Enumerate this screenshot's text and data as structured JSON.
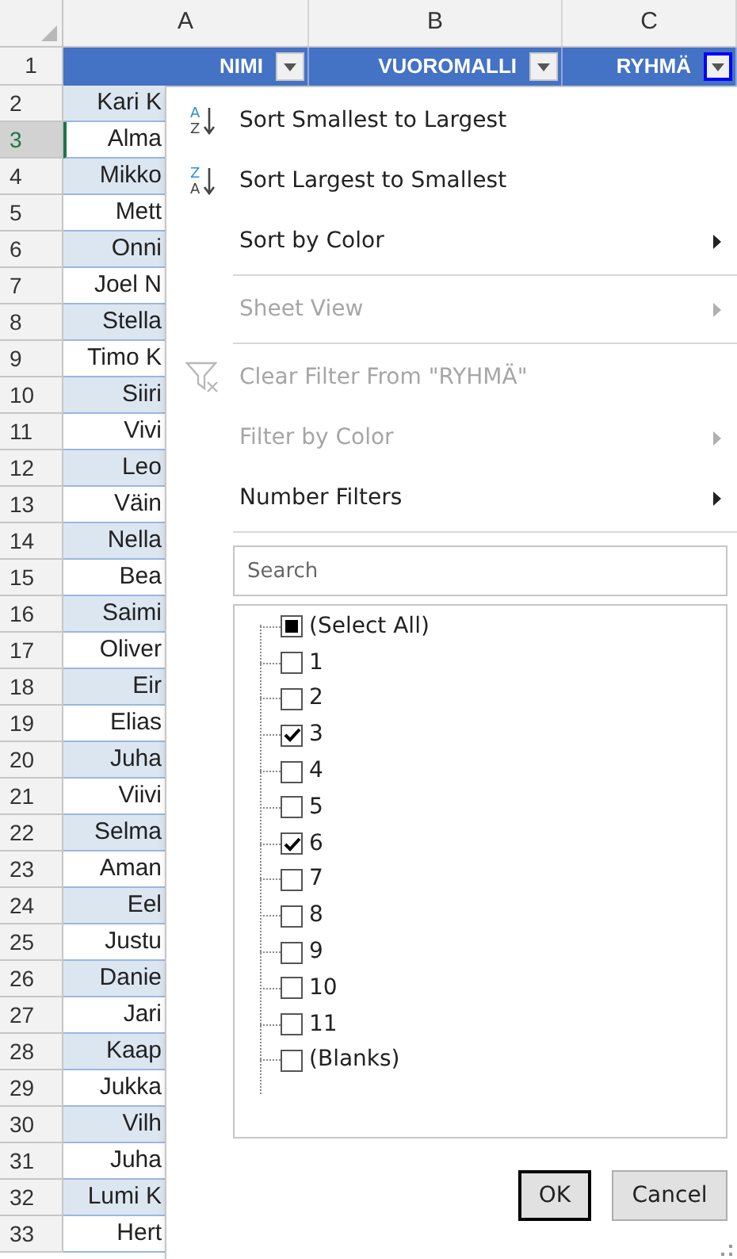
{
  "column_headers": [
    {
      "label": "A"
    },
    {
      "label": "B"
    },
    {
      "label": "C"
    }
  ],
  "header_row": {
    "number": "1",
    "cells": [
      {
        "text": "NIMI",
        "focused": false
      },
      {
        "text": "VUOROMALLI",
        "focused": false
      },
      {
        "text": "RYHMÄ",
        "focused": true
      }
    ]
  },
  "rows": [
    {
      "number": "2",
      "name": "Kari K",
      "selected": false
    },
    {
      "number": "3",
      "name": "Alma",
      "selected": true
    },
    {
      "number": "4",
      "name": "Mikko",
      "selected": false
    },
    {
      "number": "5",
      "name": "Mett",
      "selected": false
    },
    {
      "number": "6",
      "name": "Onni",
      "selected": false
    },
    {
      "number": "7",
      "name": "Joel N",
      "selected": false
    },
    {
      "number": "8",
      "name": "Stella",
      "selected": false
    },
    {
      "number": "9",
      "name": "Timo K",
      "selected": false
    },
    {
      "number": "10",
      "name": "Siiri",
      "selected": false
    },
    {
      "number": "11",
      "name": "Vivi",
      "selected": false
    },
    {
      "number": "12",
      "name": "Leo",
      "selected": false
    },
    {
      "number": "13",
      "name": "Väin",
      "selected": false
    },
    {
      "number": "14",
      "name": "Nella",
      "selected": false
    },
    {
      "number": "15",
      "name": "Bea",
      "selected": false
    },
    {
      "number": "16",
      "name": "Saimi",
      "selected": false
    },
    {
      "number": "17",
      "name": "Oliver",
      "selected": false
    },
    {
      "number": "18",
      "name": "Eir",
      "selected": false
    },
    {
      "number": "19",
      "name": "Elias",
      "selected": false
    },
    {
      "number": "20",
      "name": "Juha",
      "selected": false
    },
    {
      "number": "21",
      "name": "Viivi",
      "selected": false
    },
    {
      "number": "22",
      "name": "Selma",
      "selected": false
    },
    {
      "number": "23",
      "name": "Aman",
      "selected": false
    },
    {
      "number": "24",
      "name": "Eel",
      "selected": false
    },
    {
      "number": "25",
      "name": "Justu",
      "selected": false
    },
    {
      "number": "26",
      "name": "Danie",
      "selected": false
    },
    {
      "number": "27",
      "name": "Jari",
      "selected": false
    },
    {
      "number": "28",
      "name": "Kaap",
      "selected": false
    },
    {
      "number": "29",
      "name": "Jukka",
      "selected": false
    },
    {
      "number": "30",
      "name": "Vilh",
      "selected": false
    },
    {
      "number": "31",
      "name": "Juha",
      "selected": false
    },
    {
      "number": "32",
      "name": "Lumi K",
      "selected": false
    },
    {
      "number": "33",
      "name": "Hert",
      "selected": false
    }
  ],
  "filter_menu": {
    "items": [
      {
        "kind": "sort",
        "label": "Sort Smallest to Largest",
        "icon_top": "A",
        "icon_bottom": "Z",
        "disabled": false,
        "submenu": false
      },
      {
        "kind": "sort",
        "label": "Sort Largest to Smallest",
        "icon_top": "Z",
        "icon_bottom": "A",
        "disabled": false,
        "submenu": false
      },
      {
        "kind": "plain",
        "label": "Sort by Color",
        "disabled": false,
        "submenu": true
      },
      {
        "kind": "separator"
      },
      {
        "kind": "plain",
        "label": "Sheet View",
        "disabled": true,
        "submenu": true
      },
      {
        "kind": "separator"
      },
      {
        "kind": "clear",
        "label": "Clear Filter From \"RYHMÄ\"",
        "disabled": true,
        "submenu": false
      },
      {
        "kind": "plain",
        "label": "Filter by Color",
        "disabled": true,
        "submenu": true
      },
      {
        "kind": "plain",
        "label": "Number Filters",
        "disabled": false,
        "submenu": true
      },
      {
        "kind": "separator"
      }
    ],
    "search": {
      "placeholder": "Search"
    },
    "values": [
      {
        "label": "(Select All)",
        "checked": false,
        "mixed": true
      },
      {
        "label": "1",
        "checked": false,
        "mixed": false
      },
      {
        "label": "2",
        "checked": false,
        "mixed": false
      },
      {
        "label": "3",
        "checked": true,
        "mixed": false
      },
      {
        "label": "4",
        "checked": false,
        "mixed": false
      },
      {
        "label": "5",
        "checked": false,
        "mixed": false
      },
      {
        "label": "6",
        "checked": true,
        "mixed": false
      },
      {
        "label": "7",
        "checked": false,
        "mixed": false
      },
      {
        "label": "8",
        "checked": false,
        "mixed": false
      },
      {
        "label": "9",
        "checked": false,
        "mixed": false
      },
      {
        "label": "10",
        "checked": false,
        "mixed": false
      },
      {
        "label": "11",
        "checked": false,
        "mixed": false
      },
      {
        "label": "(Blanks)",
        "checked": false,
        "mixed": false
      }
    ],
    "buttons": [
      {
        "label": "OK",
        "default": true
      },
      {
        "label": "Cancel",
        "default": false
      }
    ]
  }
}
